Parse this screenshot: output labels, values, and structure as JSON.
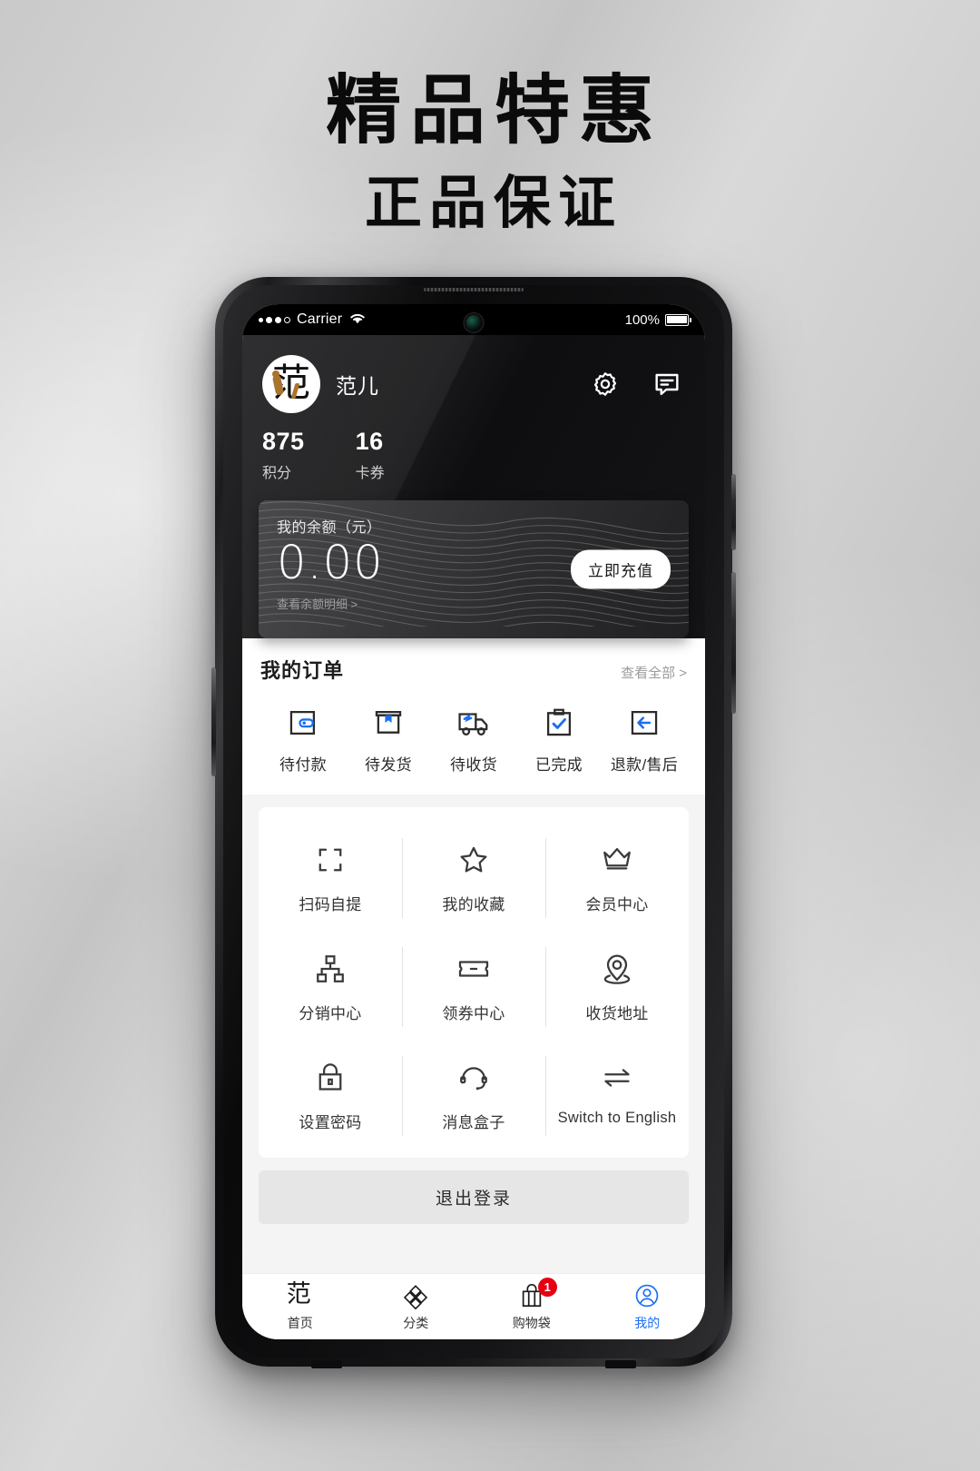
{
  "promo": {
    "line1": "精品特惠",
    "line2": "正品保证"
  },
  "status_bar": {
    "carrier": "Carrier",
    "battery_percent": "100%",
    "signal_dots": 4,
    "signal_filled": 3
  },
  "profile": {
    "avatar_glyph": "范",
    "username": "范儿",
    "settings_icon": "gear-icon",
    "message_icon": "chat-icon",
    "stats": [
      {
        "value": "875",
        "label": "积分"
      },
      {
        "value": "16",
        "label": "卡券"
      }
    ]
  },
  "balance": {
    "label": "我的余额（元）",
    "amount": "0.00",
    "detail_link": "查看余额明细 >",
    "topup_label": "立即充值"
  },
  "orders": {
    "title": "我的订单",
    "more_label": "查看全部 >",
    "items": [
      {
        "label": "待付款",
        "icon": "wallet-icon"
      },
      {
        "label": "待发货",
        "icon": "package-icon"
      },
      {
        "label": "待收货",
        "icon": "truck-icon"
      },
      {
        "label": "已完成",
        "icon": "clipboard-check-icon"
      },
      {
        "label": "退款/售后",
        "icon": "return-arrow-icon"
      }
    ]
  },
  "menu": {
    "rows": [
      [
        {
          "label": "扫码自提",
          "icon": "scan-icon"
        },
        {
          "label": "我的收藏",
          "icon": "star-icon"
        },
        {
          "label": "会员中心",
          "icon": "crown-icon"
        }
      ],
      [
        {
          "label": "分销中心",
          "icon": "network-icon"
        },
        {
          "label": "领券中心",
          "icon": "coupon-icon"
        },
        {
          "label": "收货地址",
          "icon": "location-pin-icon"
        }
      ],
      [
        {
          "label": "设置密码",
          "icon": "lock-icon"
        },
        {
          "label": "消息盒子",
          "icon": "headset-icon"
        },
        {
          "label": "Switch to English",
          "icon": "swap-arrows-icon"
        }
      ]
    ]
  },
  "logout": {
    "label": "退出登录"
  },
  "tabbar": {
    "items": [
      {
        "label": "首页",
        "icon": "home-glyph-icon",
        "active": false,
        "badge": ""
      },
      {
        "label": "分类",
        "icon": "category-diamond-icon",
        "active": false,
        "badge": ""
      },
      {
        "label": "购物袋",
        "icon": "shopping-bag-icon",
        "active": false,
        "badge": "1"
      },
      {
        "label": "我的",
        "icon": "user-circle-icon",
        "active": true,
        "badge": ""
      }
    ]
  },
  "colors": {
    "accent_blue": "#1a6ef5",
    "badge_red": "#e60012",
    "avatar_accent": "#a9742e",
    "dark_bg": "#121214"
  }
}
